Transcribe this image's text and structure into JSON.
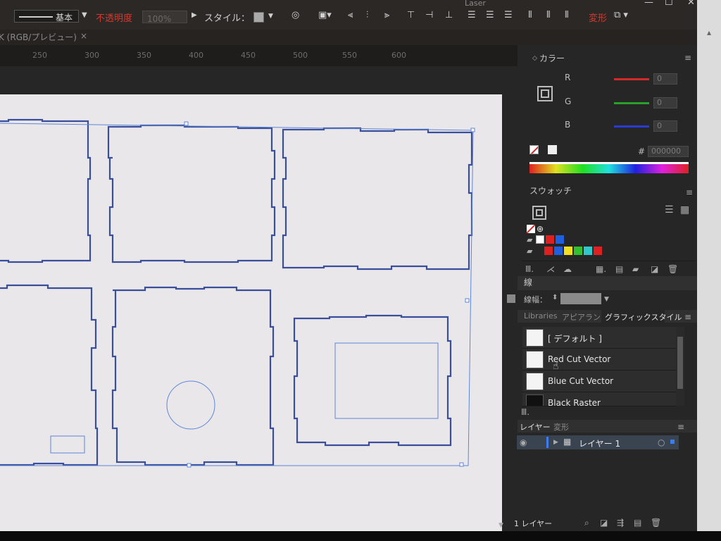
{
  "toolbar": {
    "stroke_profile": "基本",
    "opacity_label": "不透明度",
    "opacity_value": "100%",
    "style_label": "スタイル：",
    "transform_label": "変形",
    "doc_title": "Laser"
  },
  "document_tab": {
    "label": "K (RGB/プレビュー)",
    "close": "×"
  },
  "ruler": {
    "ticks": [
      "250",
      "300",
      "350",
      "400",
      "450",
      "500",
      "550",
      "600"
    ]
  },
  "color_panel": {
    "title": "カラー",
    "channels": [
      {
        "label": "R",
        "value": "0",
        "color": "#d42a2a"
      },
      {
        "label": "G",
        "value": "0",
        "color": "#2aa12a"
      },
      {
        "label": "B",
        "value": "0",
        "color": "#2a3ad4"
      }
    ],
    "hex_label": "#",
    "hex_value": "000000"
  },
  "swatches_panel": {
    "title": "スウォッチ",
    "row1": [
      "#ffffff",
      "#000000",
      "#e02020",
      "#2060e0"
    ],
    "row2": [
      "#e02020",
      "#2060e0",
      "#f0e020",
      "#30c030",
      "#30c8c8",
      "#e02020"
    ]
  },
  "stroke_panel": {
    "title": "線",
    "weight_label": "線幅："
  },
  "graphic_styles_panel": {
    "tabs": [
      "Libraries",
      "アピアランス",
      "グラフィックスタイル"
    ],
    "styles": [
      {
        "name": "[ デフォルト ]"
      },
      {
        "name": "Red Cut Vector"
      },
      {
        "name": "Blue Cut Vector"
      },
      {
        "name": "Black Raster"
      }
    ]
  },
  "layers_panel": {
    "tabs": [
      "レイヤー",
      "変形"
    ],
    "layer_name": "レイヤー 1",
    "layer_color": "#3b7cf0",
    "footer_count": "1 レイヤー"
  },
  "colors": {
    "accent": "#3b7cf0",
    "artwork_stroke": "#3a4f9c",
    "selection": "#5c86d8"
  }
}
